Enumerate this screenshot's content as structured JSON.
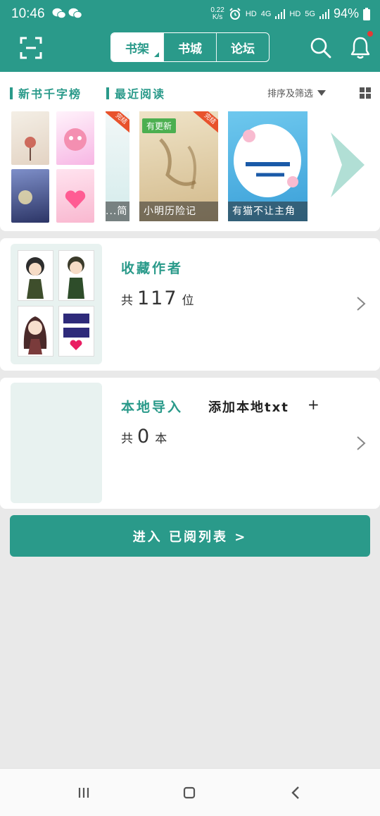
{
  "status_bar": {
    "time": "10:46",
    "net_speed_value": "0.22",
    "net_speed_unit": "K/s",
    "hd1": "HD",
    "net1": "4G",
    "hd2": "HD",
    "net2": "5G",
    "battery": "94%"
  },
  "app_bar": {
    "tabs": [
      {
        "label": "书架",
        "active": true
      },
      {
        "label": "书城",
        "active": false
      },
      {
        "label": "论坛",
        "active": false
      }
    ]
  },
  "shelf": {
    "rank_title": "新书千字榜",
    "recent_title": "最近阅读",
    "sort_filter_label": "排序及筛选",
    "books": [
      {
        "title": "...简",
        "ribbon": "完结"
      },
      {
        "title": "小明历险记",
        "badge": "有更新",
        "ribbon": "完结"
      },
      {
        "title": "有猫不让主角"
      }
    ]
  },
  "authors": {
    "title": "收藏作者",
    "count_prefix": "共",
    "count": "117",
    "count_suffix": "位"
  },
  "local_import": {
    "title": "本地导入",
    "add_label": "添加本地txt",
    "add_plus": "+",
    "count_prefix": "共",
    "count": "0",
    "count_suffix": "本"
  },
  "read_list_button": "进入 已阅列表 >",
  "colors": {
    "brand": "#2a9a8a",
    "badge_green": "#4caf50",
    "ribbon_orange": "#e8522c",
    "notification_dot": "#e53935"
  }
}
